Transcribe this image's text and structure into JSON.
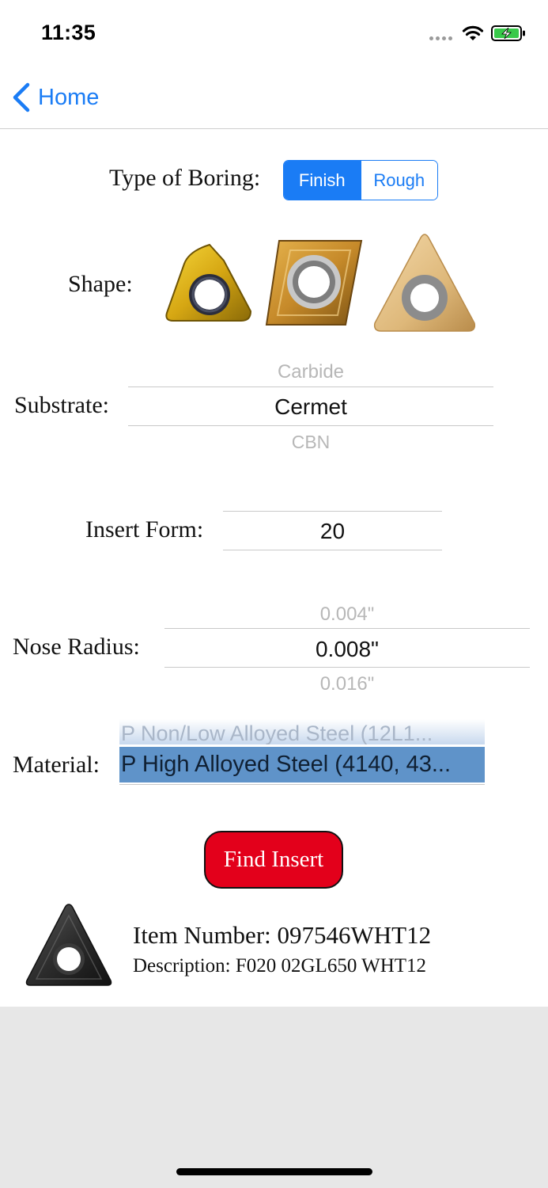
{
  "status_bar": {
    "time": "11:35"
  },
  "nav": {
    "back_label": "Home"
  },
  "boring": {
    "label": "Type of Boring:",
    "options": [
      "Finish",
      "Rough"
    ],
    "selected": "Finish",
    "accent": "#1a7cf5"
  },
  "shape": {
    "label": "Shape:",
    "images": [
      "trigon-gold-insert-icon",
      "rhombic-gold-insert-icon",
      "triangle-cermet-insert-icon"
    ]
  },
  "substrate": {
    "label": "Substrate:",
    "above": "Carbide",
    "selected": "Cermet",
    "below": "CBN"
  },
  "insert_form": {
    "label": "Insert Form:",
    "selected": "20"
  },
  "nose_radius": {
    "label": "Nose Radius:",
    "above": "0.004\"",
    "selected": "0.008\"",
    "below": "0.016\""
  },
  "material": {
    "label": "Material:",
    "above": "P Non/Low Alloyed Steel  (12L1...",
    "selected": "P High Alloyed Steel (4140, 43...",
    "highlight_color": "#5f93c9"
  },
  "find_button": {
    "label": "Find Insert",
    "color": "#e3001b"
  },
  "result": {
    "item_number": "Item Number: 097546WHT12",
    "description": "Description: F020 02GL650 WHT12"
  }
}
